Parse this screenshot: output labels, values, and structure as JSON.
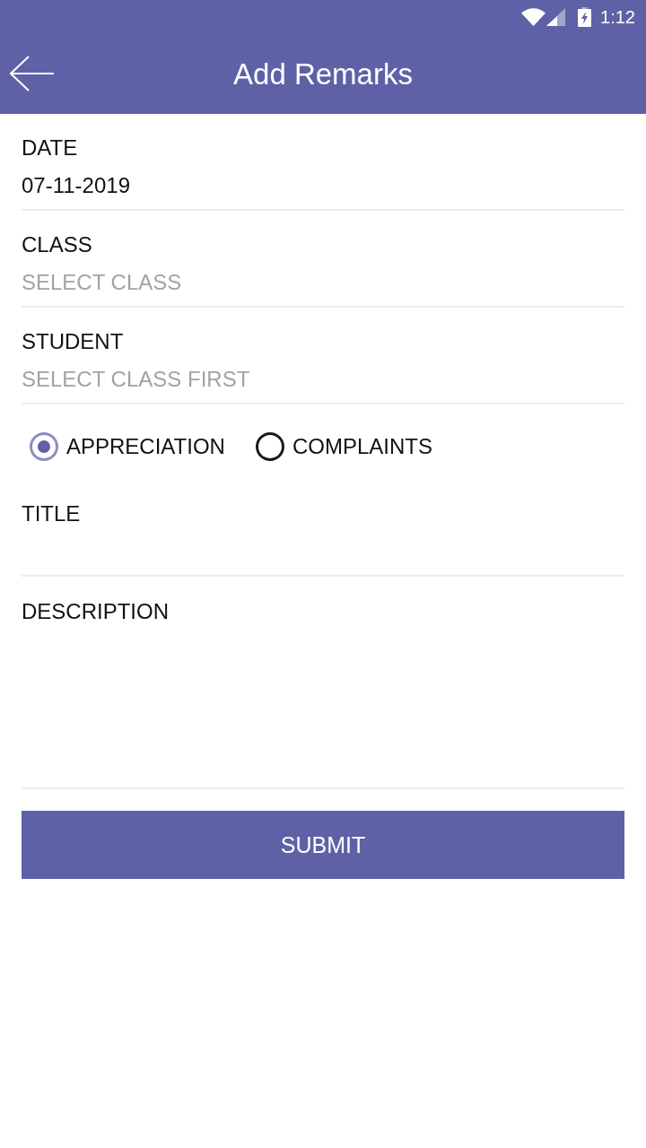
{
  "status_bar": {
    "time": "1:12"
  },
  "app_bar": {
    "title": "Add Remarks"
  },
  "fields": [
    {
      "label": "DATE",
      "value": "07-11-2019"
    },
    {
      "label": "CLASS",
      "placeholder": "SELECT CLASS"
    },
    {
      "label": "STUDENT",
      "placeholder": "SELECT CLASS FIRST"
    }
  ],
  "remark_types": [
    {
      "label": "APPRECIATION",
      "selected": true
    },
    {
      "label": "COMPLAINTS",
      "selected": false
    }
  ],
  "text_fields": [
    {
      "label": "TITLE",
      "kind": "line"
    },
    {
      "label": "DESCRIPTION",
      "kind": "area"
    }
  ],
  "submit": "SUBMIT"
}
